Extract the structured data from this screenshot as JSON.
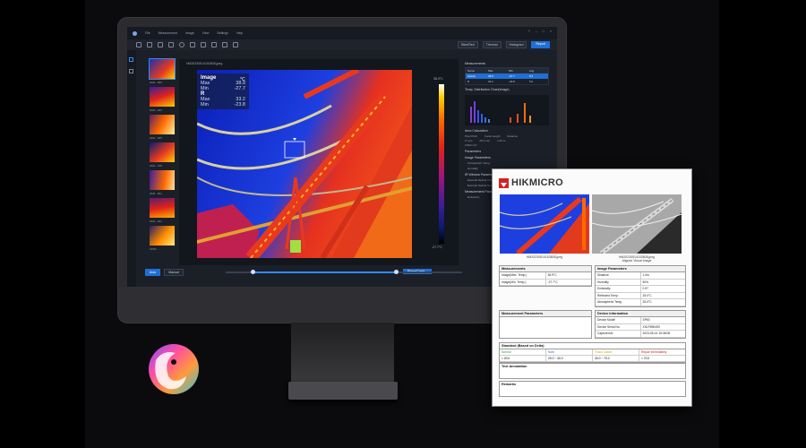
{
  "app": {
    "menu": [
      "File",
      "Measurement",
      "Image",
      "View",
      "Settings",
      "Help"
    ],
    "toolbar_selects": [
      "Blue/Red",
      "Thermal",
      "Histogram"
    ],
    "report_button": "Report",
    "window_buttons": [
      "?",
      "–",
      "□",
      "×"
    ]
  },
  "thumbs": [
    {
      "label": "HM2...859"
    },
    {
      "label": "HM2...934"
    },
    {
      "label": "HM2...065"
    },
    {
      "label": "HM2...238"
    },
    {
      "label": "HM2...804"
    },
    {
      "label": "HM2...001"
    },
    {
      "label": "SP60..."
    }
  ],
  "viewer": {
    "filename": "HM20230514153808.jpeg",
    "overlay": {
      "title": "Image",
      "unit": "°C",
      "max_label": "Max",
      "max": "38.9",
      "min_label": "Min",
      "min": "-27.7",
      "r_label": "R",
      "r_max": "33.2",
      "r_min": "-23.8"
    },
    "scale_top": "38.9°C",
    "scale_bottom": "-27.7°C",
    "phase_button": "PhaseComb..."
  },
  "bottombar": {
    "segments": [
      "Auto",
      "Manual"
    ]
  },
  "rpanel": {
    "measurements_title": "Measurements",
    "columns": [
      "Name",
      "Max",
      "Min",
      "Avg."
    ],
    "rows": [
      {
        "name": "Global",
        "max": "38.9",
        "min": "-27.7",
        "avg": "8.3"
      },
      {
        "name": "R",
        "max": "33.2",
        "min": "-23.8",
        "avg": "5.0"
      }
    ],
    "hist_title": "Temp. Distribution Chart(Image)",
    "area_title": "Area Calculation",
    "area_cols": [
      "Pixel Pitch",
      "Focal Length",
      "Distance"
    ],
    "area_vals": [
      "17 μm",
      "26.2 mm",
      "1.00 m"
    ],
    "area_result": "0.953 cm²",
    "params_title": "Parameters",
    "img_params": "Image Parameters",
    "img_items": [
      "Atmospheric Temp.",
      "Humidity"
    ],
    "ir_params": "IR Window Parameters",
    "ir_items": [
      "External Optical Transmission",
      "External Optical Temperature"
    ],
    "meas_params": "Measurement Parameters",
    "meas_items": [
      "Emissivity"
    ]
  },
  "report": {
    "brand": "HIKMICRO",
    "img1_caption": "HM20230514153808.jpeg",
    "img2_caption": "HM20230514153808.jpeg\nAligned Visual Image",
    "measurements": {
      "title": "Measurements",
      "rows": [
        [
          "Image(Max. Temp.)",
          "38.9°C"
        ],
        [
          "Image(Min. Temp.)",
          "-27.7°C"
        ]
      ]
    },
    "image_params": {
      "title": "Image Parameters",
      "rows": [
        [
          "Distance",
          "1.0m"
        ],
        [
          "Humidity",
          "50%"
        ],
        [
          "Emissivity",
          "0.97"
        ],
        [
          "Reflected Temp.",
          "25.0°C"
        ],
        [
          "Atmospheric Temp.",
          "25.0°C"
        ]
      ]
    },
    "meas_params_title": "Measurement Parameters",
    "device_info": {
      "title": "Device Information",
      "rows": [
        [
          "Device Model",
          "SP60"
        ],
        [
          "Device Serial No.",
          "XS1F890493"
        ],
        [
          "Captured At",
          "2023-05-14 15:38:08"
        ]
      ]
    },
    "standard": {
      "title": "Standard (Based on Delta)",
      "labels": [
        "Normal",
        "Note",
        "Focus Cases",
        "Repair Immediately"
      ],
      "values": [
        "< 20.0",
        "20.0 ~ 40.0",
        "40.0 ~ 70.0",
        "> 70.0"
      ]
    },
    "text_annotation": "Text Annotation",
    "remarks": "Remarks"
  },
  "colors": {
    "accent": "#1f6fd6",
    "normal": "#2e9d3c",
    "note": "#3070c0",
    "focus": "#d8a300",
    "repair": "#d02020"
  }
}
